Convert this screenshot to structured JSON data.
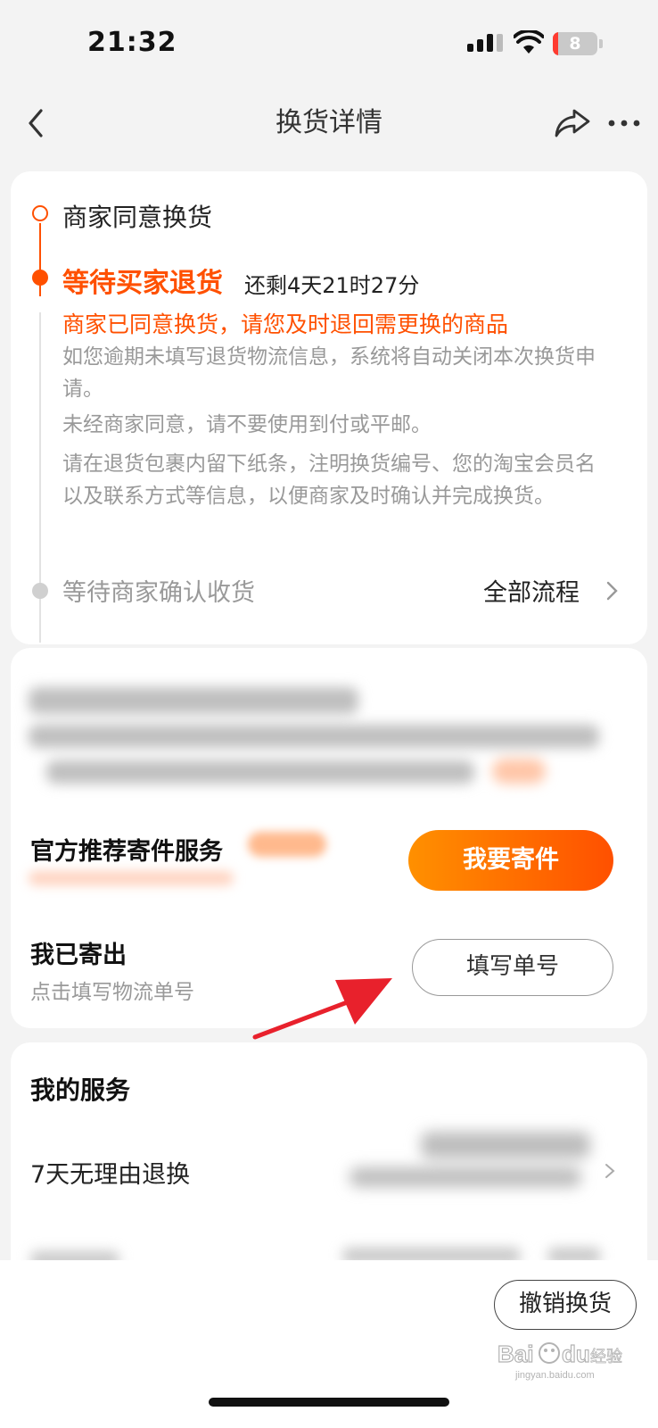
{
  "status_bar": {
    "time": "21:32",
    "battery": "8"
  },
  "nav": {
    "title": "换货详情"
  },
  "timeline": {
    "step1": "商家同意换货",
    "step2_title": "等待买家退货",
    "step2_remaining": "还剩4天21时27分",
    "step2_notice": "商家已同意换货，请您及时退回需更换的商品",
    "step2_desc": [
      "如您逾期未填写退货物流信息，系统将自动关闭本次换货申请。",
      "未经商家同意，请不要使用到付或平邮。",
      "请在退货包裹内留下纸条，注明换货编号、您的淘宝会员名以及联系方式等信息，以便商家及时确认并完成换货。"
    ],
    "step3": "等待商家确认收货",
    "all_flow": "全部流程"
  },
  "shipping": {
    "service_title": "官方推荐寄件服务",
    "send_button": "我要寄件",
    "sent_title": "我已寄出",
    "sent_sub": "点击填写物流单号",
    "fill_button": "填写单号"
  },
  "services": {
    "title": "我的服务",
    "row1": "7天无理由退换"
  },
  "bottom": {
    "cancel_button": "撤销换货",
    "watermark": "Baidu 经验",
    "watermark_sub": "jingyan.baidu.com"
  },
  "colors": {
    "accent": "#ff5000",
    "accent_gradient_start": "#ff9000"
  }
}
